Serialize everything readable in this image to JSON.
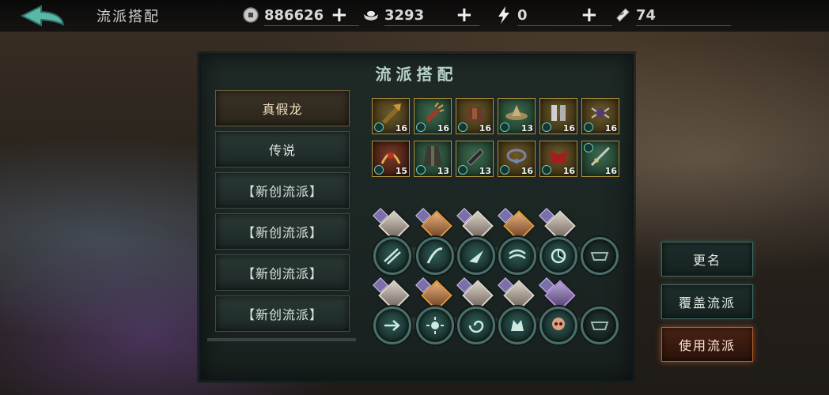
{
  "header": {
    "title": "流派搭配",
    "resources": [
      {
        "icon": "coin-icon",
        "value": "886626"
      },
      {
        "icon": "silver-ingot-icon",
        "value": "3293"
      },
      {
        "icon": "lightning-icon",
        "value": "0"
      },
      {
        "icon": "ticket-icon",
        "value": "74"
      }
    ]
  },
  "panel": {
    "title": "流派搭配",
    "presets": [
      {
        "label": "真假龙",
        "active": true
      },
      {
        "label": "传说",
        "active": false
      },
      {
        "label": "【新创流派】",
        "active": false
      },
      {
        "label": "【新创流派】",
        "active": false
      },
      {
        "label": "【新创流派】",
        "active": false
      },
      {
        "label": "【新创流派】",
        "active": false
      }
    ],
    "equipment_row1": [
      {
        "icon": "gauntlet-icon",
        "level": "16",
        "rarity": "gold"
      },
      {
        "icon": "claw-glove-icon",
        "level": "16",
        "rarity": "green"
      },
      {
        "icon": "armor-icon",
        "level": "16",
        "rarity": "gold"
      },
      {
        "icon": "hat-icon",
        "level": "13",
        "rarity": "green"
      },
      {
        "icon": "greaves-icon",
        "level": "16",
        "rarity": "gold"
      },
      {
        "icon": "spider-charm-icon",
        "level": "16",
        "rarity": "gold"
      }
    ],
    "equipment_row2": [
      {
        "icon": "dragon-claw-icon",
        "level": "15",
        "rarity": "red"
      },
      {
        "icon": "cloak-icon",
        "level": "13",
        "rarity": "green"
      },
      {
        "icon": "bracer-icon",
        "level": "13",
        "rarity": "green"
      },
      {
        "icon": "necklace-icon",
        "level": "16",
        "rarity": "gold"
      },
      {
        "icon": "red-sash-icon",
        "level": "16",
        "rarity": "gold"
      },
      {
        "icon": "sword-icon",
        "level": "16",
        "rarity": "green"
      }
    ]
  },
  "actions": {
    "rename": "更名",
    "overwrite": "覆盖流派",
    "use": "使用流派"
  },
  "colors": {
    "accent_teal": "#4a6e69",
    "accent_orange": "#b65a2c",
    "panel_bg": "#1f2a27"
  }
}
